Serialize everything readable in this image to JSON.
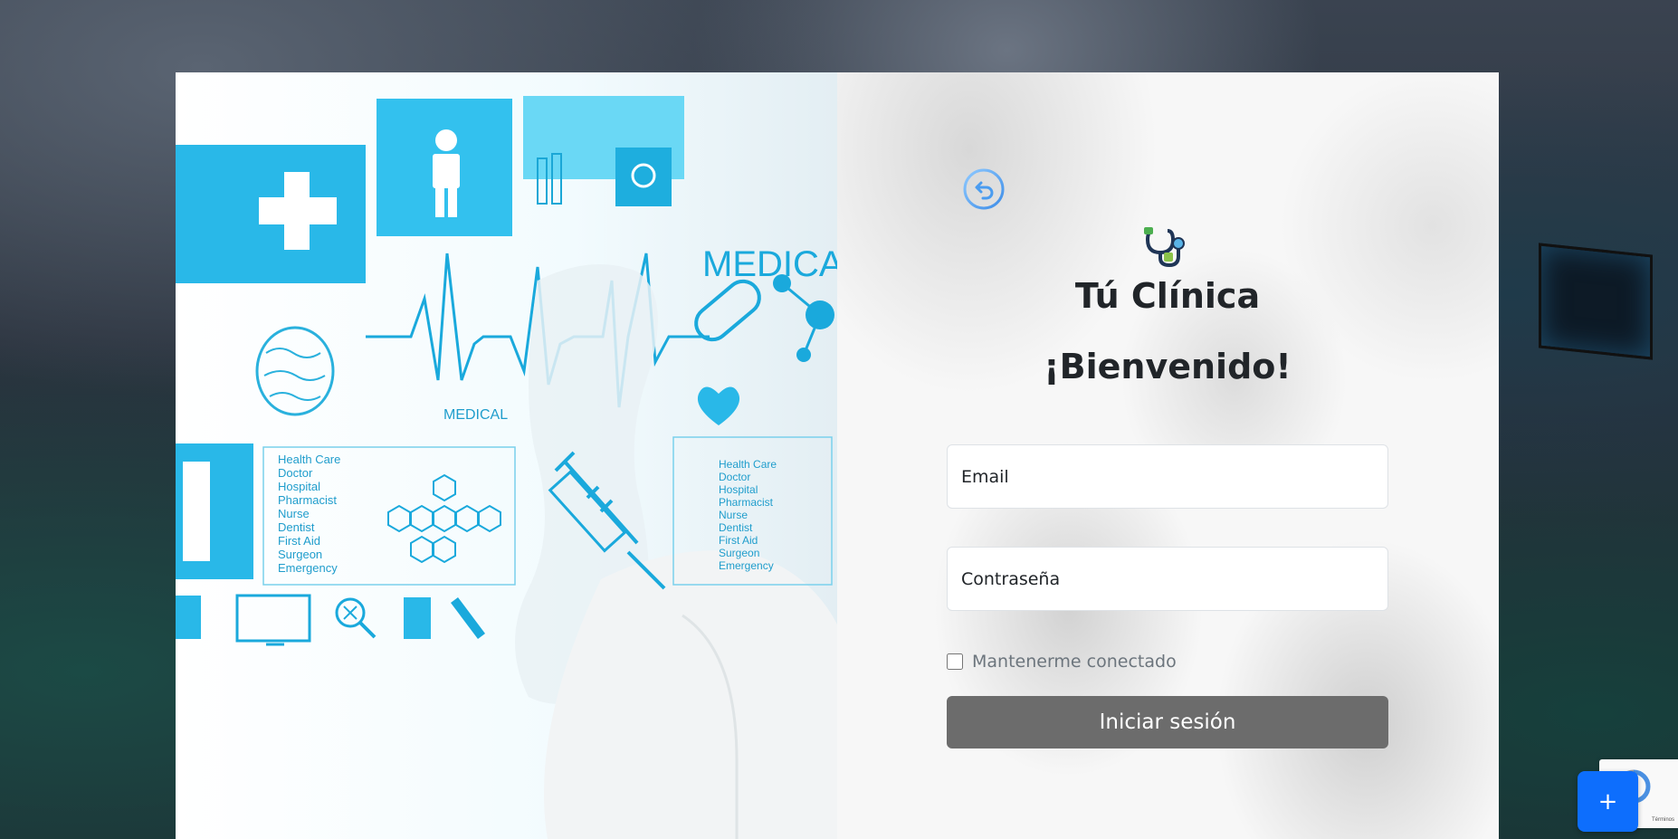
{
  "brand": {
    "title": "Tú Clínica"
  },
  "login": {
    "heading": "¡Bienvenido!",
    "email_placeholder": "Email",
    "password_placeholder": "Contraseña",
    "remember_label": "Mantenerme conectado",
    "submit_label": "Iniciar sesión"
  },
  "hero": {
    "medical_label_1": "MEDICA",
    "medical_label_2": "MEDICAL",
    "list_left": [
      "Health Care",
      "Doctor",
      "Hospital",
      "Pharmacist",
      "Nurse",
      "Dentist",
      "First Aid",
      "Surgeon",
      "Emergency"
    ],
    "list_right": [
      "Health Care",
      "Doctor",
      "Hospital",
      "Pharmacist",
      "Nurse",
      "Dentist",
      "First Aid",
      "Surgeon",
      "Emergency"
    ]
  },
  "recaptcha": {
    "terms": "Términos"
  },
  "fab": {
    "label": "+"
  },
  "colors": {
    "accent": "#0d6efd",
    "button": "#6c6c6c",
    "hero_cyan": "#29b6e0",
    "text": "#212529"
  },
  "icons": [
    "back-icon",
    "stethoscope-logo-icon",
    "plus-icon"
  ]
}
